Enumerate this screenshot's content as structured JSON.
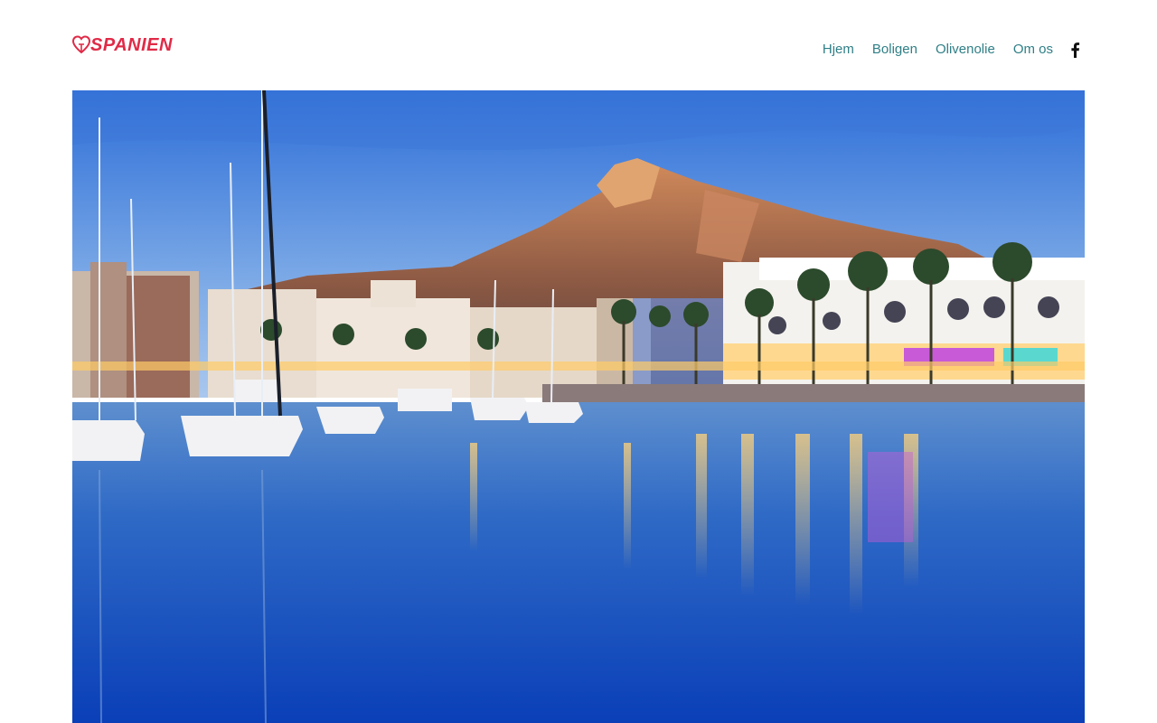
{
  "brand": {
    "name": "SPANIEN",
    "color": "#e02a47",
    "icon": "heart-icon"
  },
  "nav": {
    "color": "#2f7f86",
    "items": [
      {
        "label": "Hjem"
      },
      {
        "label": "Boligen"
      },
      {
        "label": "Olivenolie"
      },
      {
        "label": "Om os"
      }
    ]
  },
  "social": {
    "icon": "facebook-icon"
  },
  "hero": {
    "image": "harbor-photo",
    "colors": {
      "sky_top": "#2d6ed8",
      "sky_bottom": "#8fb8e8",
      "water_top": "#3b7ec8",
      "water_bottom": "#0a3fb8",
      "lights": "#ffd27a"
    }
  }
}
